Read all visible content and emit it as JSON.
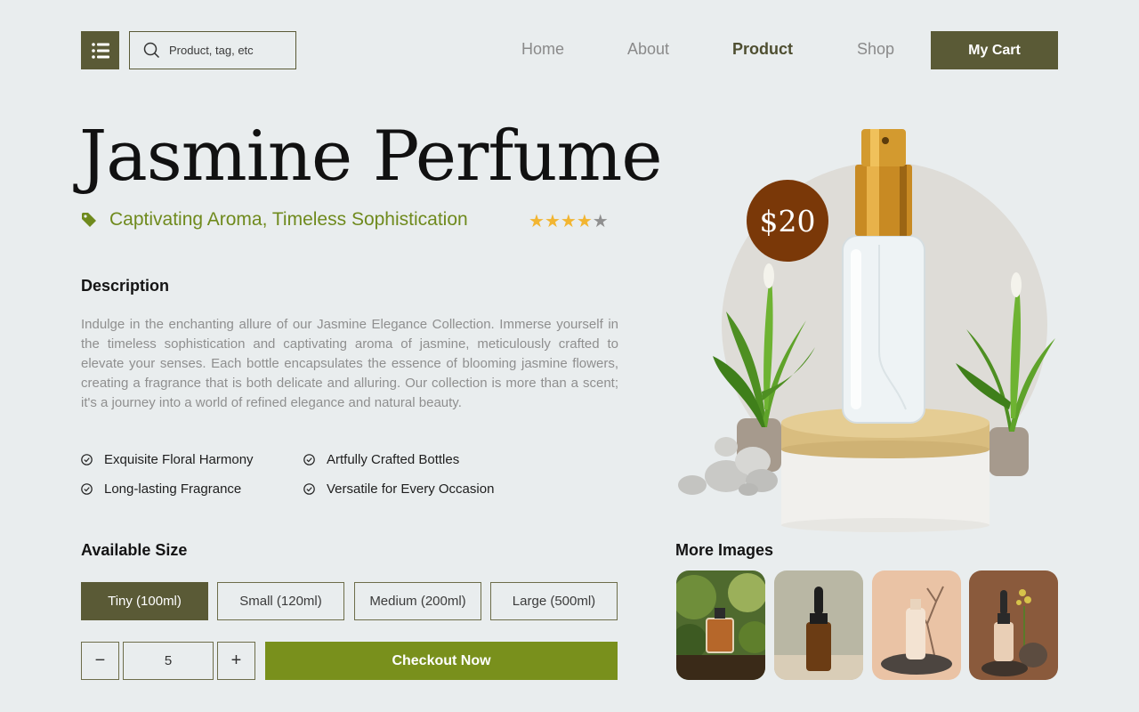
{
  "header": {
    "search_placeholder": "Product, tag, etc",
    "nav": [
      "Home",
      "About",
      "Product",
      "Shop"
    ],
    "active_nav": "Product",
    "cart_label": "My Cart",
    "brand_color": "#5a5a36"
  },
  "product": {
    "title": "Jasmine Perfume",
    "tagline": "Captivating Aroma, Timeless Sophistication",
    "rating": 4,
    "rating_max": 5,
    "price": "$20",
    "description_heading": "Description",
    "description": "Indulge in the enchanting allure of our Jasmine Elegance Collection. Immerse yourself in the timeless sophistication and captivating aroma of jasmine, meticulously crafted to elevate your senses. Each bottle encapsulates the essence of blooming jasmine flowers, creating a fragrance that is both delicate and alluring. Our collection is more than a scent; it's a journey into a world of refined elegance and natural beauty.",
    "features": [
      "Exquisite Floral Harmony",
      "Artfully Crafted Bottles",
      "Long-lasting Fragrance",
      "Versatile for Every Occasion"
    ]
  },
  "sizes": {
    "heading": "Available Size",
    "options": [
      "Tiny (100ml)",
      "Small (120ml)",
      "Medium (200ml)",
      "Large (500ml)"
    ],
    "selected": "Tiny (100ml)"
  },
  "quantity": {
    "minus": "−",
    "value": "5",
    "plus": "+"
  },
  "checkout_label": "Checkout Now",
  "gallery": {
    "heading": "More Images",
    "thumbnails": [
      "perfume-bottle-plants",
      "dropper-bottle-amber",
      "lotion-bottle-branch",
      "dropper-bottle-flowers"
    ]
  },
  "colors": {
    "accent_green": "#79901c",
    "tagline_green": "#6f8a1d",
    "price_badge": "#7a3808",
    "star": "#f2b531"
  }
}
